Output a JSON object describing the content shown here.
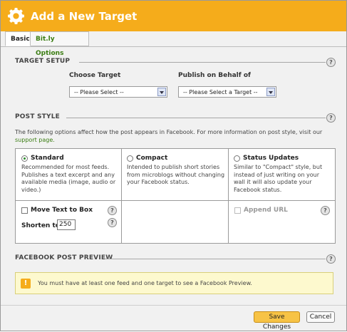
{
  "dialog": {
    "title": "Add a New Target",
    "icon": "gear-icon"
  },
  "tabs": [
    {
      "label": "Basic",
      "active": true
    },
    {
      "label": "Bit.ly Options",
      "active": false
    }
  ],
  "target_setup": {
    "heading": "TARGET SETUP",
    "choose_target_label": "Choose Target",
    "choose_target_value": "-- Please Select --",
    "publish_label": "Publish on Behalf of",
    "publish_value": "-- Please Select a Target --"
  },
  "post_style": {
    "heading": "POST STYLE",
    "description": "The following options affect how the post appears in Facebook. For more information on post style, visit our",
    "link_text": "support page.",
    "options": [
      {
        "title": "Standard",
        "selected": true,
        "description": "Recommended for most feeds. Publishes a text excerpt and any available media (image, audio or video.)"
      },
      {
        "title": "Compact",
        "selected": false,
        "description": "Intended to publish short stories from microblogs without changing your Facebook status."
      },
      {
        "title": "Status Updates",
        "selected": false,
        "description": "Similar to \"Compact\" style, but instead of just writing on your wall it will also update your Facebook status."
      }
    ],
    "move_text_label": "Move Text to Box",
    "shorten_label": "Shorten to",
    "shorten_value": "250",
    "append_url_label": "Append URL"
  },
  "preview": {
    "heading": "FACEBOOK POST PREVIEW",
    "message": "You must have at least one feed and one target to see a Facebook Preview.",
    "warning_icon_text": "!"
  },
  "help_icon_text": "?",
  "buttons": {
    "save": "Save Changes",
    "cancel": "Cancel"
  },
  "colors": {
    "title_bar": "#f5ac1b",
    "link": "#3a7d12",
    "save_button": "#f7c346",
    "preview_bg": "#fdf9ce"
  }
}
